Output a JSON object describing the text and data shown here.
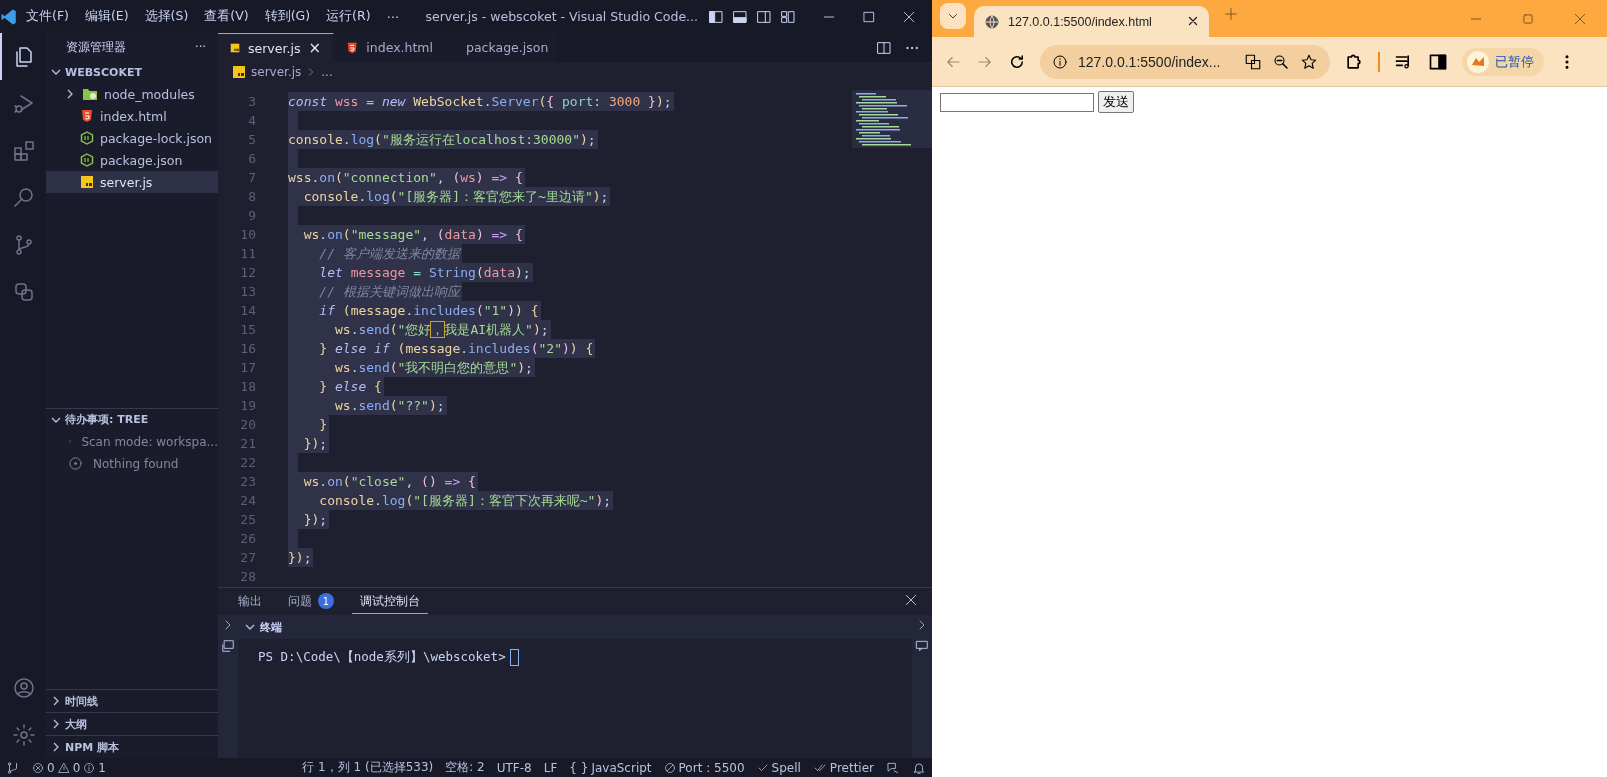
{
  "vscode": {
    "menu": [
      "文件(F)",
      "编辑(E)",
      "选择(S)",
      "查看(V)",
      "转到(G)",
      "运行(R)",
      "⋯"
    ],
    "title": "server.js - webscoket - Visual Studio Code...",
    "activity_bar": [
      {
        "kind": "files",
        "selected": true
      },
      {
        "kind": "run",
        "selected": false
      },
      {
        "kind": "extensions",
        "selected": false
      },
      {
        "kind": "search",
        "selected": false
      },
      {
        "kind": "git",
        "selected": false
      },
      {
        "kind": "remote",
        "selected": false
      }
    ],
    "sidebar": {
      "title": "资源管理器",
      "more": "···",
      "folder": {
        "name": "WEBSCOKET",
        "expanded": true,
        "items": [
          {
            "name": "node_modules",
            "kind": "folder",
            "expanded": false,
            "selected": false
          },
          {
            "name": "index.html",
            "kind": "html",
            "selected": false
          },
          {
            "name": "package-lock.json",
            "kind": "node",
            "selected": false
          },
          {
            "name": "package.json",
            "kind": "node",
            "selected": false
          },
          {
            "name": "server.js",
            "kind": "js",
            "selected": true
          }
        ]
      },
      "todo": {
        "title": "待办事项: TREE",
        "expanded": true,
        "items": [
          {
            "kind": "search",
            "text": "Scan mode: workspa..."
          },
          {
            "kind": "info",
            "text": "Nothing found"
          }
        ]
      },
      "sections": [
        {
          "title": "时间线",
          "expanded": false
        },
        {
          "title": "大纲",
          "expanded": false
        },
        {
          "title": "NPM 脚本",
          "expanded": false
        }
      ]
    },
    "tabs": [
      {
        "name": "server.js",
        "kind": "js",
        "selected": true,
        "close": "×"
      },
      {
        "name": "index.html",
        "kind": "html",
        "selected": false
      },
      {
        "name": "package.json",
        "kind": "node",
        "selected": false
      }
    ],
    "breadcrumb": {
      "file": "server.js",
      "kind": "js",
      "rest": "..."
    },
    "editor": {
      "lines": [
        {
          "number": "3",
          "selected": true,
          "text": "const wss = new WebSocket.Server({ port: 3000 });"
        },
        {
          "number": "4",
          "selected": true
        },
        {
          "number": "5",
          "selected": true,
          "text": "console.log(\"服务运行在localhost:30000\");"
        },
        {
          "number": "6",
          "selected": true
        },
        {
          "number": "7",
          "selected": true,
          "text": "wss.on(\"connection\", (ws) => {"
        },
        {
          "number": "8",
          "selected": true,
          "text": "  console.log(\"[服务器]：客官您来了~里边请\");"
        },
        {
          "number": "9",
          "selected": true
        },
        {
          "number": "10",
          "selected": true,
          "text": "  ws.on(\"message\", (data) => {"
        },
        {
          "number": "11",
          "selected": true,
          "text": "    // 客户端发送来的数据"
        },
        {
          "number": "12",
          "selected": true,
          "text": "    let message = String(data);"
        },
        {
          "number": "13",
          "selected": true,
          "text": "    // 根据关键词做出响应"
        },
        {
          "number": "14",
          "selected": true,
          "text": "    if (message.includes(\"1\")) {"
        },
        {
          "number": "15",
          "selected": true,
          "text": "      ws.send(\"您好，我是AI机器人\");"
        },
        {
          "number": "16",
          "selected": true,
          "text": "    } else if (message.includes(\"2\")) {"
        },
        {
          "number": "17",
          "selected": true,
          "text": "      ws.send(\"我不明白您的意思\");"
        },
        {
          "number": "18",
          "selected": true,
          "text": "    } else {"
        },
        {
          "number": "19",
          "selected": true,
          "text": "      ws.send(\"??\");"
        },
        {
          "number": "20",
          "selected": true,
          "text": "    }"
        },
        {
          "number": "21",
          "selected": true,
          "text": "  });"
        },
        {
          "number": "22",
          "selected": true
        },
        {
          "number": "23",
          "selected": true,
          "text": "  ws.on(\"close\", () => {"
        },
        {
          "number": "24",
          "selected": true,
          "text": "    console.log(\"[服务器]：客官下次再来呢~\");"
        },
        {
          "number": "25",
          "selected": true,
          "text": "  });"
        },
        {
          "number": "26",
          "selected": true
        },
        {
          "number": "27",
          "selected": true,
          "text": "});"
        },
        {
          "number": "28",
          "selected": false
        }
      ]
    },
    "panel": {
      "tabs": [
        {
          "label": "输出",
          "selected": false
        },
        {
          "label": "问题",
          "badge": "1",
          "selected": false
        },
        {
          "label": "调试控制台",
          "selected": true
        }
      ],
      "terminal": {
        "title": "终端",
        "expanded": true,
        "prompt": "PS D:\\Code\\【node系列】\\webscoket>"
      }
    },
    "status_bar": {
      "errors": "0",
      "warnings": "0",
      "infos": "1",
      "items": [
        {
          "kind": "text",
          "text": "行 1，列 1 (已选择533)"
        },
        {
          "kind": "text",
          "text": "空格: 2"
        },
        {
          "kind": "text",
          "text": "UTF-8"
        },
        {
          "kind": "text",
          "text": "LF"
        },
        {
          "kind": "language",
          "icon": "{ }",
          "text": "JavaScript"
        },
        {
          "kind": "port",
          "text": "Port : 5500"
        },
        {
          "kind": "check",
          "text": "Spell"
        },
        {
          "kind": "double-check",
          "text": "Prettier"
        }
      ]
    }
  },
  "browser": {
    "tab": {
      "title": "127.0.0.1:5500/index.html"
    },
    "address": "127.0.0.1:5500/index...",
    "profile": "已暂停",
    "page": {
      "button": "发送"
    }
  }
}
